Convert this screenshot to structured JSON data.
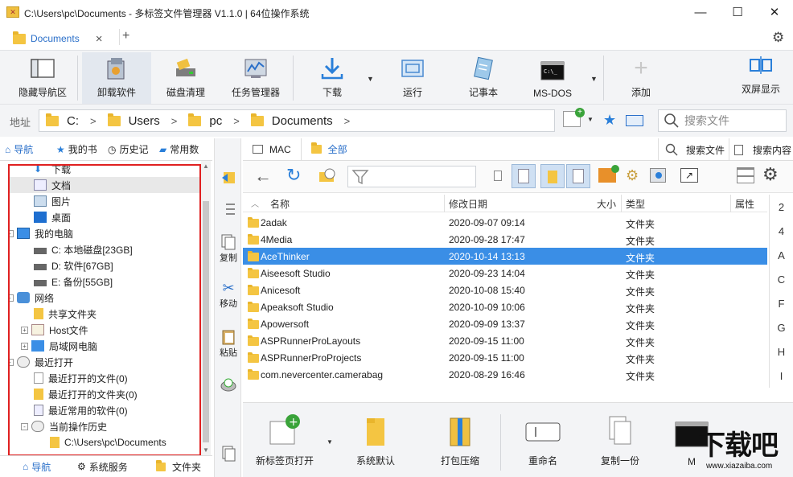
{
  "window": {
    "title": "C:\\Users\\pc\\Documents - 多标签文件管理器 V1.1.0  |  64位操作系统",
    "minimize_glyph": "—",
    "maximize_glyph": "☐",
    "close_glyph": "✕"
  },
  "tabs": {
    "active_label": "Documents",
    "close_glyph": "×",
    "add_glyph": "+"
  },
  "toolbar": {
    "items": [
      {
        "label": "隐藏导航区",
        "icon": "panel-icon"
      },
      {
        "label": "卸载软件",
        "icon": "uninstall-icon"
      },
      {
        "label": "磁盘清理",
        "icon": "disk-clean-icon"
      },
      {
        "label": "任务管理器",
        "icon": "task-manager-icon"
      },
      {
        "label": "下载",
        "icon": "download-icon"
      },
      {
        "label": "运行",
        "icon": "run-icon"
      },
      {
        "label": "记事本",
        "icon": "notepad-icon"
      },
      {
        "label": "MS-DOS",
        "icon": "cmd-icon"
      },
      {
        "label": "添加",
        "icon": "add-icon"
      },
      {
        "label": "双屏显示",
        "icon": "dual-screen-icon"
      }
    ]
  },
  "address": {
    "label": "地址",
    "crumbs": [
      "C:",
      "Users",
      "pc",
      "Documents"
    ],
    "search_placeholder": "搜索文件"
  },
  "left_pane": {
    "tabs": [
      "导航",
      "我的书",
      "历史记",
      "常用数"
    ],
    "tree": [
      {
        "label": "下载",
        "indent": 1,
        "icon": "download"
      },
      {
        "label": "文档",
        "indent": 1,
        "icon": "doc",
        "selected": true
      },
      {
        "label": "图片",
        "indent": 1,
        "icon": "picture"
      },
      {
        "label": "桌面",
        "indent": 1,
        "icon": "desktop"
      },
      {
        "label": "我的电脑",
        "indent": 0,
        "icon": "computer",
        "expander": "-"
      },
      {
        "label": "C: 本地磁盘[23GB]",
        "indent": 1,
        "icon": "drive"
      },
      {
        "label": "D: 软件[67GB]",
        "indent": 1,
        "icon": "drive"
      },
      {
        "label": "E: 备份[55GB]",
        "indent": 1,
        "icon": "drive"
      },
      {
        "label": "网络",
        "indent": 0,
        "icon": "network",
        "expander": "-"
      },
      {
        "label": "共享文件夹",
        "indent": 1,
        "icon": "share"
      },
      {
        "label": "Host文件",
        "indent": 1,
        "icon": "hostfile",
        "expander": "+"
      },
      {
        "label": "局域网电脑",
        "indent": 1,
        "icon": "lan",
        "expander": "+"
      },
      {
        "label": "最近打开",
        "indent": 0,
        "icon": "recent",
        "expander": "-"
      },
      {
        "label": "最近打开的文件(0)",
        "indent": 1,
        "icon": "file"
      },
      {
        "label": "最近打开的文件夹(0)",
        "indent": 1,
        "icon": "folder"
      },
      {
        "label": "最近常用的软件(0)",
        "indent": 1,
        "icon": "app"
      },
      {
        "label": "当前操作历史",
        "indent": 1,
        "icon": "history",
        "expander": "-"
      },
      {
        "label": "C:\\Users\\pc\\Documents",
        "indent": 2,
        "icon": "folder"
      }
    ],
    "bottom_tabs": [
      "导航",
      "系统服务",
      "文件夹"
    ]
  },
  "mid_strip": {
    "copy": "复制",
    "move": "移动",
    "paste": "粘贴"
  },
  "right_pane": {
    "tabs": [
      "MAC",
      "全部"
    ],
    "search_file": "搜索文件",
    "search_content": "搜索内容",
    "columns": {
      "name": "名称",
      "date": "修改日期",
      "size": "大小",
      "type": "类型",
      "attr": "属性"
    },
    "rows": [
      {
        "name": "2adak",
        "date": "2020-09-07 09:14",
        "type": "文件夹"
      },
      {
        "name": "4Media",
        "date": "2020-09-28 17:47",
        "type": "文件夹"
      },
      {
        "name": "AceThinker",
        "date": "2020-10-14 13:13",
        "type": "文件夹",
        "selected": true
      },
      {
        "name": "Aiseesoft Studio",
        "date": "2020-09-23 14:04",
        "type": "文件夹"
      },
      {
        "name": "Anicesoft",
        "date": "2020-10-08 15:40",
        "type": "文件夹"
      },
      {
        "name": "Apeaksoft Studio",
        "date": "2020-10-09 10:06",
        "type": "文件夹"
      },
      {
        "name": "Apowersoft",
        "date": "2020-09-09 13:37",
        "type": "文件夹"
      },
      {
        "name": "ASPRunnerProLayouts",
        "date": "2020-09-15 11:00",
        "type": "文件夹"
      },
      {
        "name": "ASPRunnerProProjects",
        "date": "2020-09-15 11:00",
        "type": "文件夹"
      },
      {
        "name": "com.nevercenter.camerabag",
        "date": "2020-08-29 16:46",
        "type": "文件夹"
      }
    ],
    "alpha_index": [
      "2",
      "4",
      "A",
      "C",
      "F",
      "G",
      "H",
      "I"
    ]
  },
  "bottom_bar": {
    "items": [
      "新标签页打开",
      "系统默认",
      "打包压缩",
      "重命名",
      "复制一份",
      "M"
    ]
  },
  "watermark": {
    "text": "下载吧",
    "url_text": "www.xiazaiba.com"
  },
  "colors": {
    "accent": "#3a8ee6",
    "folder": "#f4c542",
    "highlight_border": "#e02020"
  }
}
